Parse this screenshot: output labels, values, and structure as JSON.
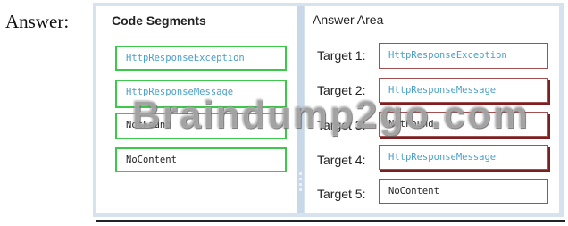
{
  "answer_label": "Answer:",
  "code_segments": {
    "title": "Code Segments",
    "items": [
      "HttpResponseException",
      "HttpResponseMessage",
      "NotFound",
      "NoContent"
    ]
  },
  "answer_area": {
    "title": "Answer Area",
    "targets": [
      {
        "label": "Target 1:",
        "value": "HttpResponseException"
      },
      {
        "label": "Target 2:",
        "value": "HttpResponseMessage"
      },
      {
        "label": "Target 3:",
        "value": "NotFound"
      },
      {
        "label": "Target 4:",
        "value": "HttpResponseMessage"
      },
      {
        "label": "Target 5:",
        "value": "NoContent"
      }
    ]
  },
  "watermark": "Braindump2go.com",
  "colors": {
    "segment_border": "#3cc84a",
    "target_border": "#a05050",
    "keyword_text": "#4aa0c8",
    "panel_frame": "#d6e2ee"
  }
}
